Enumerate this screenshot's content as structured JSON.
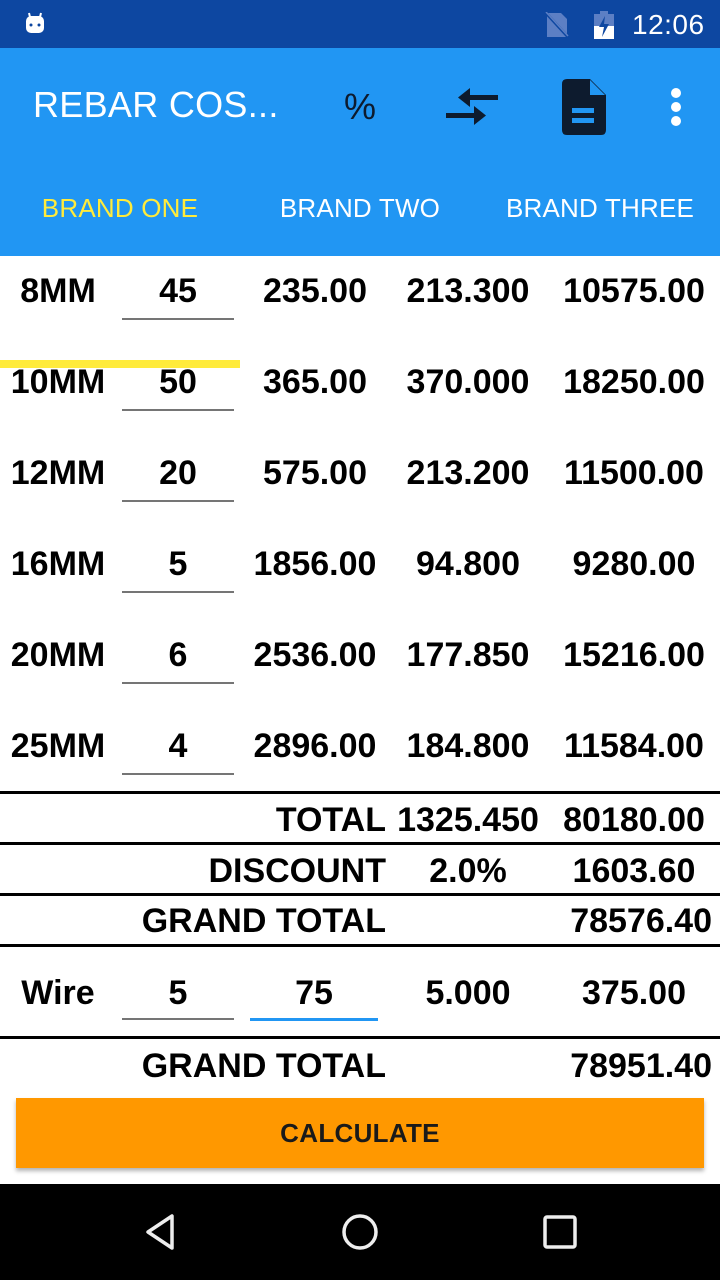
{
  "status_bar": {
    "time": "12:06",
    "icons": [
      "android-notification-icon",
      "no-sim-icon",
      "battery-charging-icon"
    ]
  },
  "app_bar": {
    "title": "REBAR COS...",
    "actions": [
      {
        "name": "percent",
        "glyph": "%"
      },
      {
        "name": "compare-arrows-icon"
      },
      {
        "name": "document-icon"
      },
      {
        "name": "more-vert-icon"
      }
    ]
  },
  "tabs": [
    {
      "label": "BRAND ONE",
      "active": true
    },
    {
      "label": "BRAND TWO",
      "active": false
    },
    {
      "label": "BRAND THREE",
      "active": false
    }
  ],
  "colors": {
    "status_bar": "#0d47a1",
    "app_bar": "#2196f3",
    "tab_active": "#ffeb3b",
    "button": "#ff9800",
    "input_focus": "#2196f3"
  },
  "rows": [
    {
      "size": "8MM",
      "qty": "45",
      "price": "235.00",
      "weight": "213.300",
      "amount": "10575.00"
    },
    {
      "size": "10MM",
      "qty": "50",
      "price": "365.00",
      "weight": "370.000",
      "amount": "18250.00"
    },
    {
      "size": "12MM",
      "qty": "20",
      "price": "575.00",
      "weight": "213.200",
      "amount": "11500.00"
    },
    {
      "size": "16MM",
      "qty": "5",
      "price": "1856.00",
      "weight": "94.800",
      "amount": "9280.00"
    },
    {
      "size": "20MM",
      "qty": "6",
      "price": "2536.00",
      "weight": "177.850",
      "amount": "15216.00"
    },
    {
      "size": "25MM",
      "qty": "4",
      "price": "2896.00",
      "weight": "184.800",
      "amount": "11584.00"
    }
  ],
  "summary": {
    "total_label": "TOTAL",
    "total_weight": "1325.450",
    "total_amount": "80180.00",
    "discount_label": "DISCOUNT",
    "discount_percent": "2.0%",
    "discount_amount": "1603.60",
    "grand_total_label": "GRAND TOTAL",
    "grand_total": "78576.40"
  },
  "wire": {
    "label": "Wire",
    "qty": "5",
    "price": "75",
    "weight": "5.000",
    "amount": "375.00"
  },
  "final": {
    "grand_total_label": "GRAND TOTAL",
    "grand_total": "78951.40"
  },
  "calculate_label": "CALCULATE",
  "nav": [
    "back",
    "home",
    "recents"
  ]
}
